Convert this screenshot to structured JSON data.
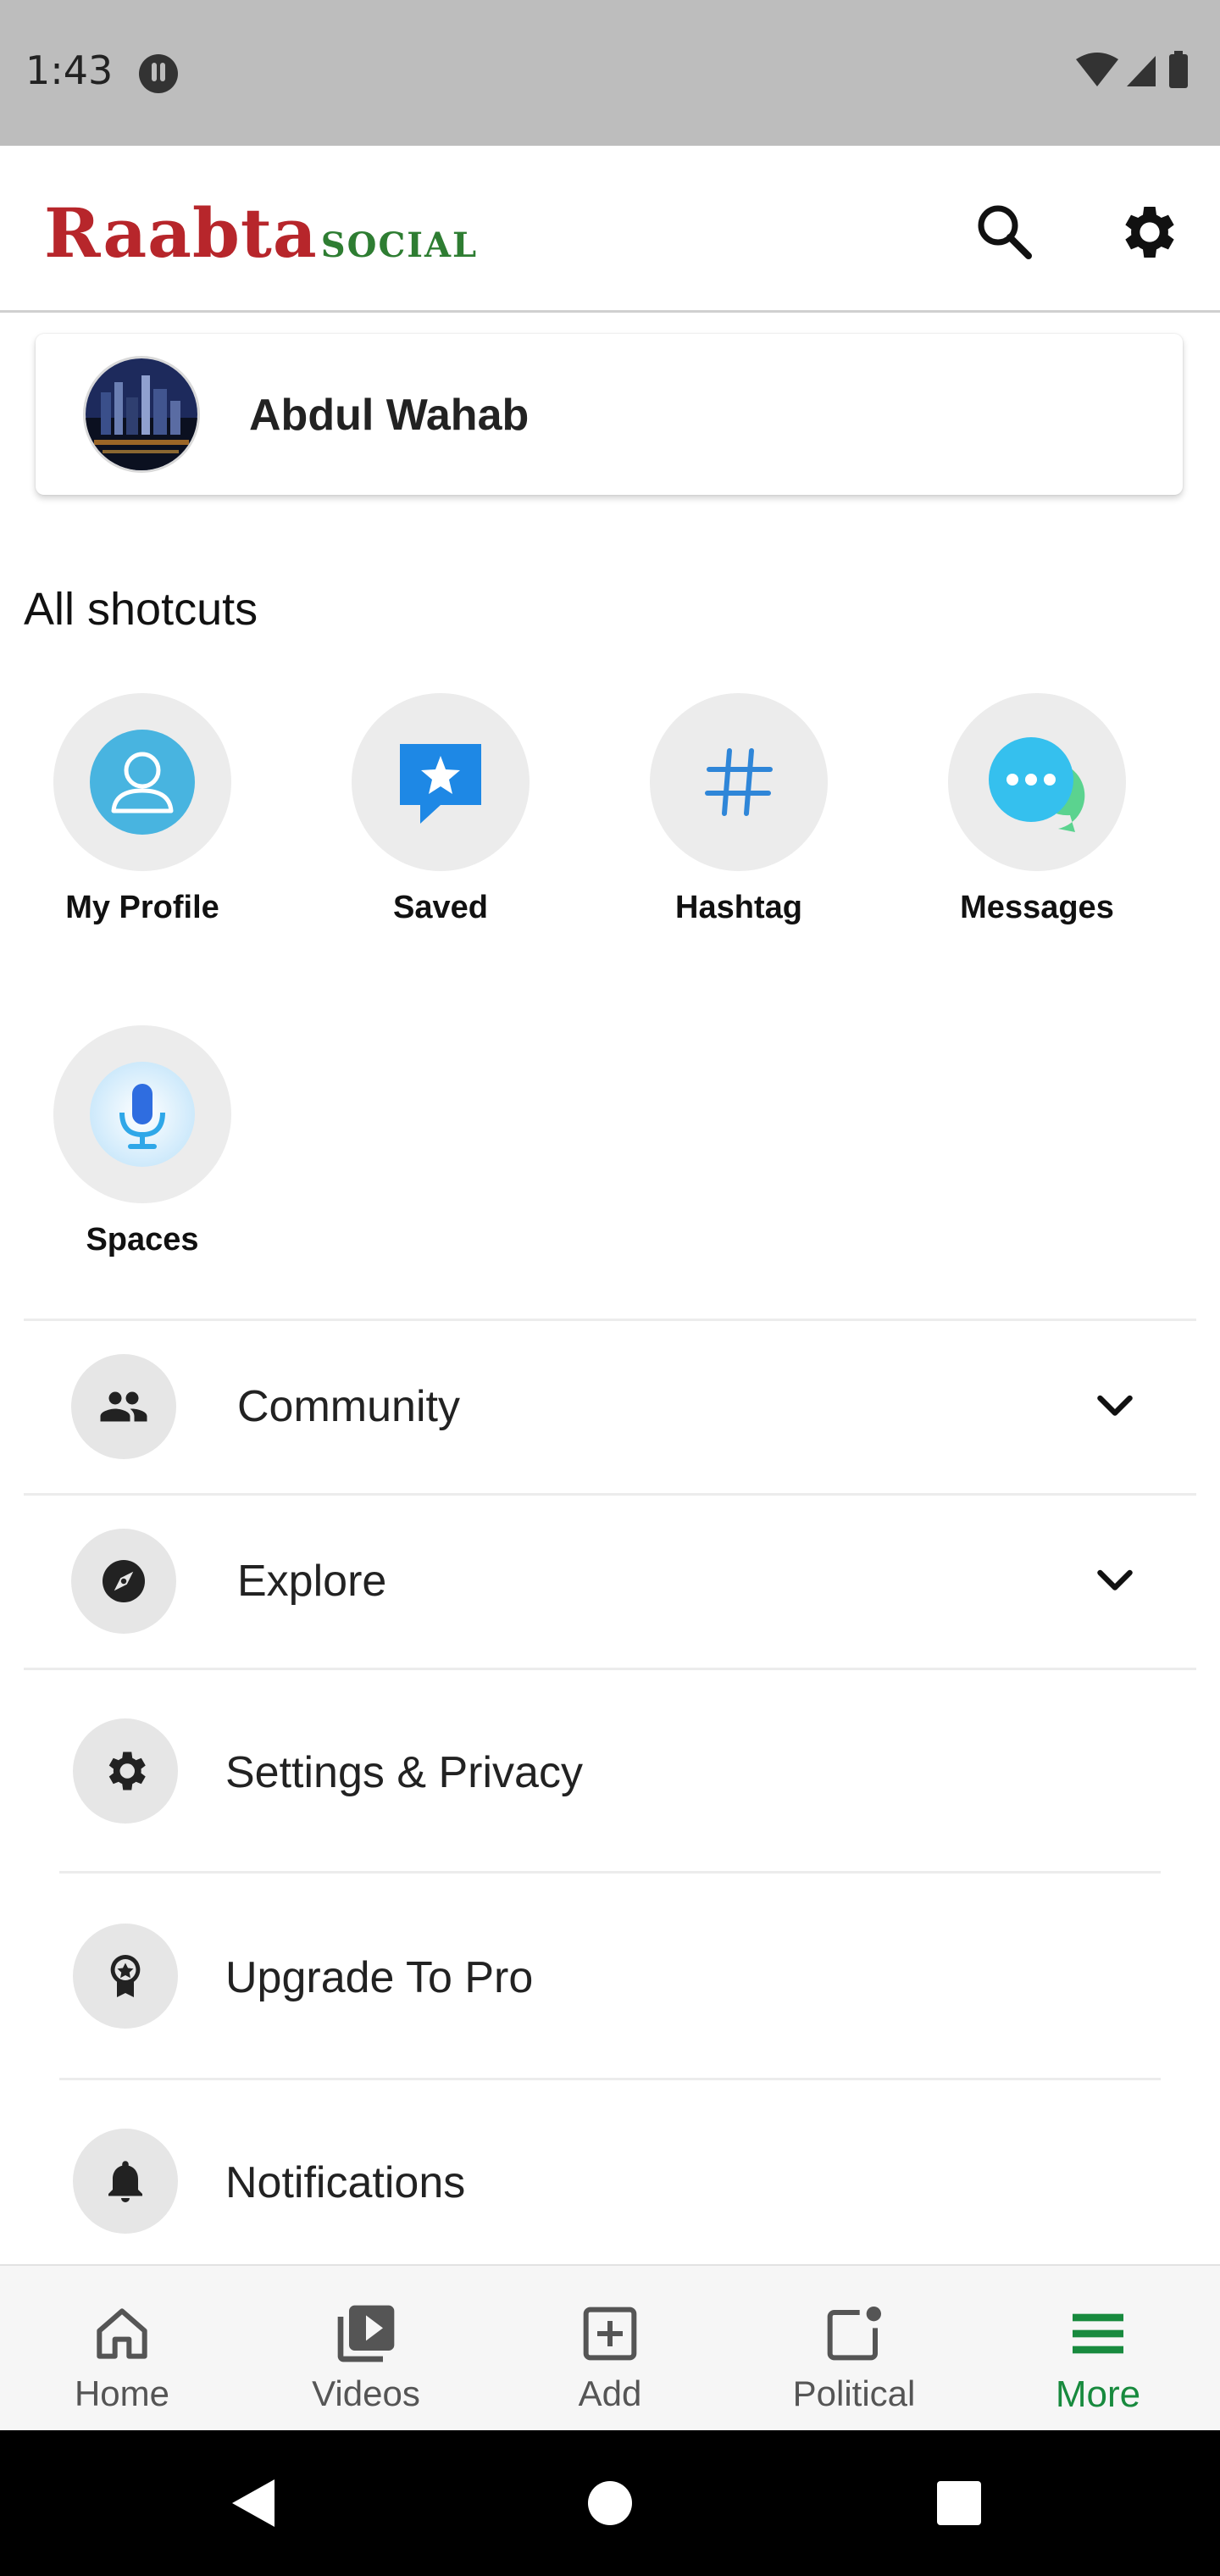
{
  "status_bar": {
    "time": "1:43"
  },
  "app_bar": {
    "logo_main": "Raabta",
    "logo_sub": "SOCIAL",
    "search_icon": "search-icon",
    "settings_icon": "gear-icon"
  },
  "profile": {
    "name": "Abdul Wahab"
  },
  "shortcuts_title": "All shotcuts",
  "shortcuts": [
    {
      "label": "My Profile",
      "icon": "person-icon"
    },
    {
      "label": "Saved",
      "icon": "saved-star-icon"
    },
    {
      "label": "Hashtag",
      "icon": "hashtag-icon"
    },
    {
      "label": "Messages",
      "icon": "chat-bubble-icon"
    },
    {
      "label": "Spaces",
      "icon": "microphone-icon"
    }
  ],
  "menu": [
    {
      "label": "Community",
      "icon": "people-icon",
      "expandable": true
    },
    {
      "label": "Explore",
      "icon": "compass-icon",
      "expandable": true
    },
    {
      "label": "Settings & Privacy",
      "icon": "gear-icon",
      "expandable": false
    },
    {
      "label": "Upgrade To Pro",
      "icon": "badge-icon",
      "expandable": false
    },
    {
      "label": "Notifications",
      "icon": "bell-icon",
      "expandable": false
    }
  ],
  "bottom_nav": [
    {
      "label": "Home",
      "icon": "home-icon"
    },
    {
      "label": "Videos",
      "icon": "video-library-icon"
    },
    {
      "label": "Add",
      "icon": "add-box-icon"
    },
    {
      "label": "Political",
      "icon": "political-icon"
    },
    {
      "label": "More",
      "icon": "menu-icon",
      "active": true
    }
  ],
  "colors": {
    "brand_red": "#b7262b",
    "brand_green": "#2e7d32",
    "active_nav": "#188a3e",
    "status_bar": "#bdbdbd"
  }
}
